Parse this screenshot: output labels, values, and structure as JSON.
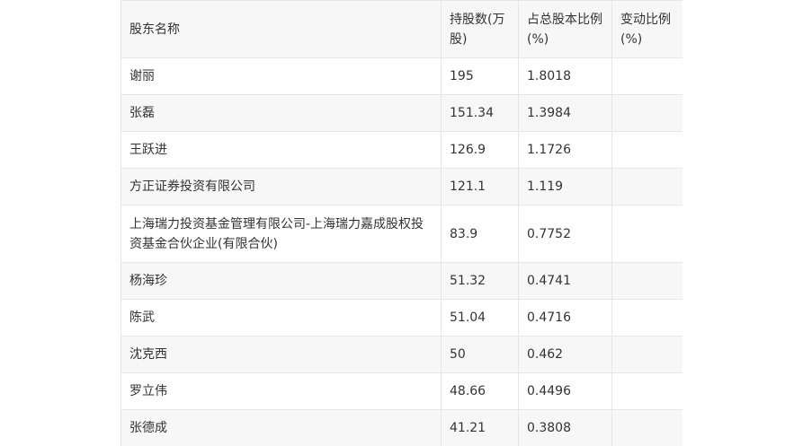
{
  "table": {
    "headers": [
      "股东名称",
      "持股数(万股)",
      "占总股本比例(%)",
      "变动比例(%)"
    ],
    "rows": [
      {
        "name": "谢丽",
        "shares": "195",
        "ratio": "1.8018",
        "change": ""
      },
      {
        "name": "张磊",
        "shares": "151.34",
        "ratio": "1.3984",
        "change": ""
      },
      {
        "name": "王跃进",
        "shares": "126.9",
        "ratio": "1.1726",
        "change": ""
      },
      {
        "name": "方正证券投资有限公司",
        "shares": "121.1",
        "ratio": "1.119",
        "change": ""
      },
      {
        "name": "上海瑞力投资基金管理有限公司-上海瑞力嘉成股权投资基金合伙企业(有限合伙)",
        "shares": "83.9",
        "ratio": "0.7752",
        "change": ""
      },
      {
        "name": "杨海珍",
        "shares": "51.32",
        "ratio": "0.4741",
        "change": ""
      },
      {
        "name": "陈武",
        "shares": "51.04",
        "ratio": "0.4716",
        "change": ""
      },
      {
        "name": "沈克西",
        "shares": "50",
        "ratio": "0.462",
        "change": ""
      },
      {
        "name": "罗立伟",
        "shares": "48.66",
        "ratio": "0.4496",
        "change": ""
      },
      {
        "name": "张德成",
        "shares": "41.21",
        "ratio": "0.3808",
        "change": ""
      }
    ]
  }
}
